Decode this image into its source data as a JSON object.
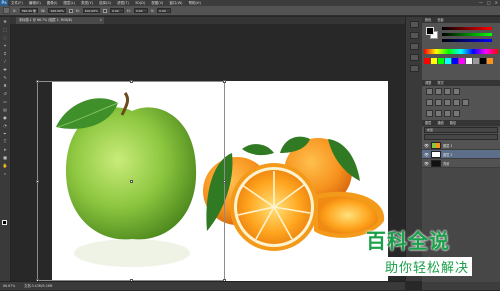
{
  "app": {
    "logo": "Ps",
    "window_controls": [
      "—",
      "□",
      "✕"
    ]
  },
  "menu": [
    "文件(F)",
    "编辑(E)",
    "图像(I)",
    "图层(L)",
    "类型(Y)",
    "选择(S)",
    "滤镜(T)",
    "3D(D)",
    "视图(V)",
    "窗口(W)",
    "帮助(H)"
  ],
  "options": {
    "x_label": "X:",
    "x_value": "390.00 像",
    "w_label": "W:",
    "w_value": "100.00%",
    "h_label": "H:",
    "h_value": "100.00%",
    "angle_value": "0.00",
    "h2_label": "H:",
    "h2_value": "0.00",
    "v_label": "V:",
    "v_value": "0.00"
  },
  "document_tab": {
    "title": "未标题-1 @ 66.7% (图层 1, RGB/8)",
    "close": "×"
  },
  "status": {
    "zoom": "66.67%",
    "doc_size": "文档:3.43M/9.26M"
  },
  "panels": {
    "color_tab": "颜色",
    "swatches_tab": "色板",
    "adjust_tab": "调整",
    "styles_tab": "样式",
    "layers_tab": "图层",
    "channels_tab": "通道",
    "paths_tab": "路径",
    "filter_placeholder": "类型",
    "layers": [
      {
        "name": "图层 1",
        "visible": "👁",
        "thumb": "img",
        "active": false
      },
      {
        "name": "图层 2",
        "visible": "👁",
        "thumb": "white",
        "active": true
      },
      {
        "name": "背景",
        "visible": "👁",
        "thumb": "black",
        "active": false
      }
    ]
  },
  "watermark": {
    "title": "百科全说",
    "subtitle": "助你轻松解决"
  },
  "colors": {
    "accent": "#1aa04a",
    "layer_highlight": "#5c6e8a"
  }
}
